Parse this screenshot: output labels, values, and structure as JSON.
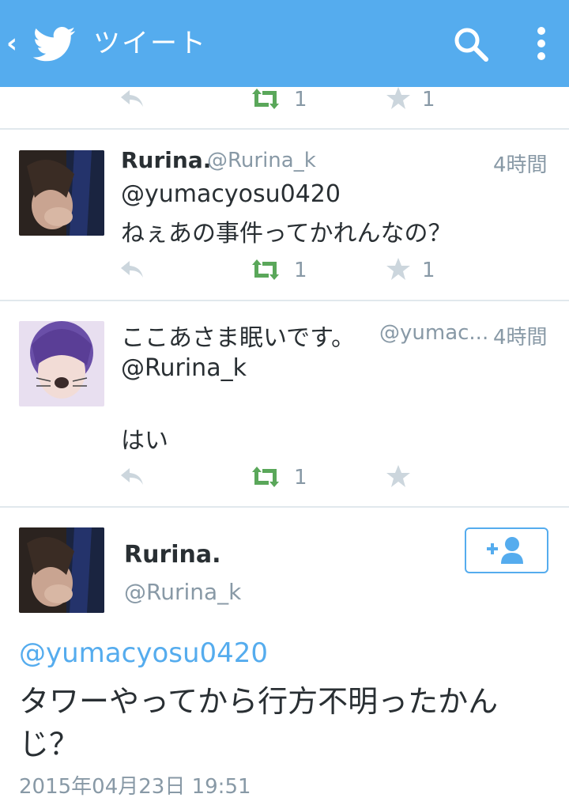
{
  "header": {
    "back_icon": "‹",
    "title": "ツイート"
  },
  "top_actions": {
    "retweets": "1",
    "favorites": "1"
  },
  "tweets": [
    {
      "name": "Rurina.",
      "handle": "@Rurina_k",
      "time": "4時間",
      "lines": [
        "@yumacyosu0420",
        "ねぇあの事件ってかれんなの？"
      ],
      "retweets": "1",
      "favorites": "1"
    },
    {
      "name": "ここあさま眠いです。",
      "handle": "@yumac...",
      "time": "4時間",
      "lines": [
        "@Rurina_k",
        "はい"
      ],
      "retweets": "1",
      "favorites": ""
    }
  ],
  "focus": {
    "name": "Rurina.",
    "handle": "@Rurina_k",
    "mention": "@yumacyosu0420",
    "text_line1": "タワーやってから行方不明ったかん",
    "text_line2": "じ？",
    "date": "2015年04月23日 19:51"
  },
  "colors": {
    "accent": "#55acee",
    "retweet": "#5aa75a",
    "muted": "#8899a6",
    "divider": "#e1e8ed"
  },
  "icons": [
    "twitter-bird-icon",
    "search-icon",
    "more-icon",
    "reply-icon",
    "retweet-icon",
    "favorite-icon",
    "follow-icon"
  ]
}
